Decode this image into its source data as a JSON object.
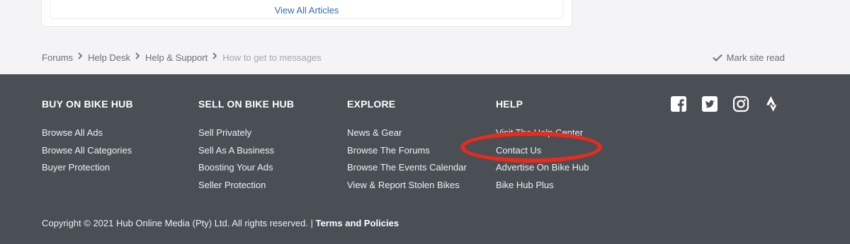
{
  "card": {
    "view_all_label": "View All Articles"
  },
  "breadcrumb": {
    "items": [
      "Forums",
      "Help Desk",
      "Help & Support"
    ],
    "current": "How to get to messages"
  },
  "mark_read_label": "Mark site read",
  "footer": {
    "columns": [
      {
        "title": "BUY ON BIKE HUB",
        "links": [
          "Browse All Ads",
          "Browse All Categories",
          "Buyer Protection"
        ]
      },
      {
        "title": "SELL ON BIKE HUB",
        "links": [
          "Sell Privately",
          "Sell As A Business",
          "Boosting Your Ads",
          "Seller Protection"
        ]
      },
      {
        "title": "EXPLORE",
        "links": [
          "News & Gear",
          "Browse The Forums",
          "Browse The Events Calendar",
          "View & Report Stolen Bikes"
        ]
      },
      {
        "title": "HELP",
        "links": [
          "Visit The Help Center",
          "Contact Us",
          "Advertise On Bike Hub",
          "Bike Hub Plus"
        ]
      }
    ],
    "social_icons": [
      "facebook-icon",
      "twitter-icon",
      "instagram-icon",
      "strava-icon"
    ],
    "copyright_text": "Copyright © 2021 Hub Online Media (Pty) Ltd. All rights reserved. |",
    "terms_label": "Terms and Policies"
  },
  "colors": {
    "footer_bg": "#4a4f55",
    "link_blue": "#2f6fb4",
    "annotation_red": "#ea2a1c"
  }
}
